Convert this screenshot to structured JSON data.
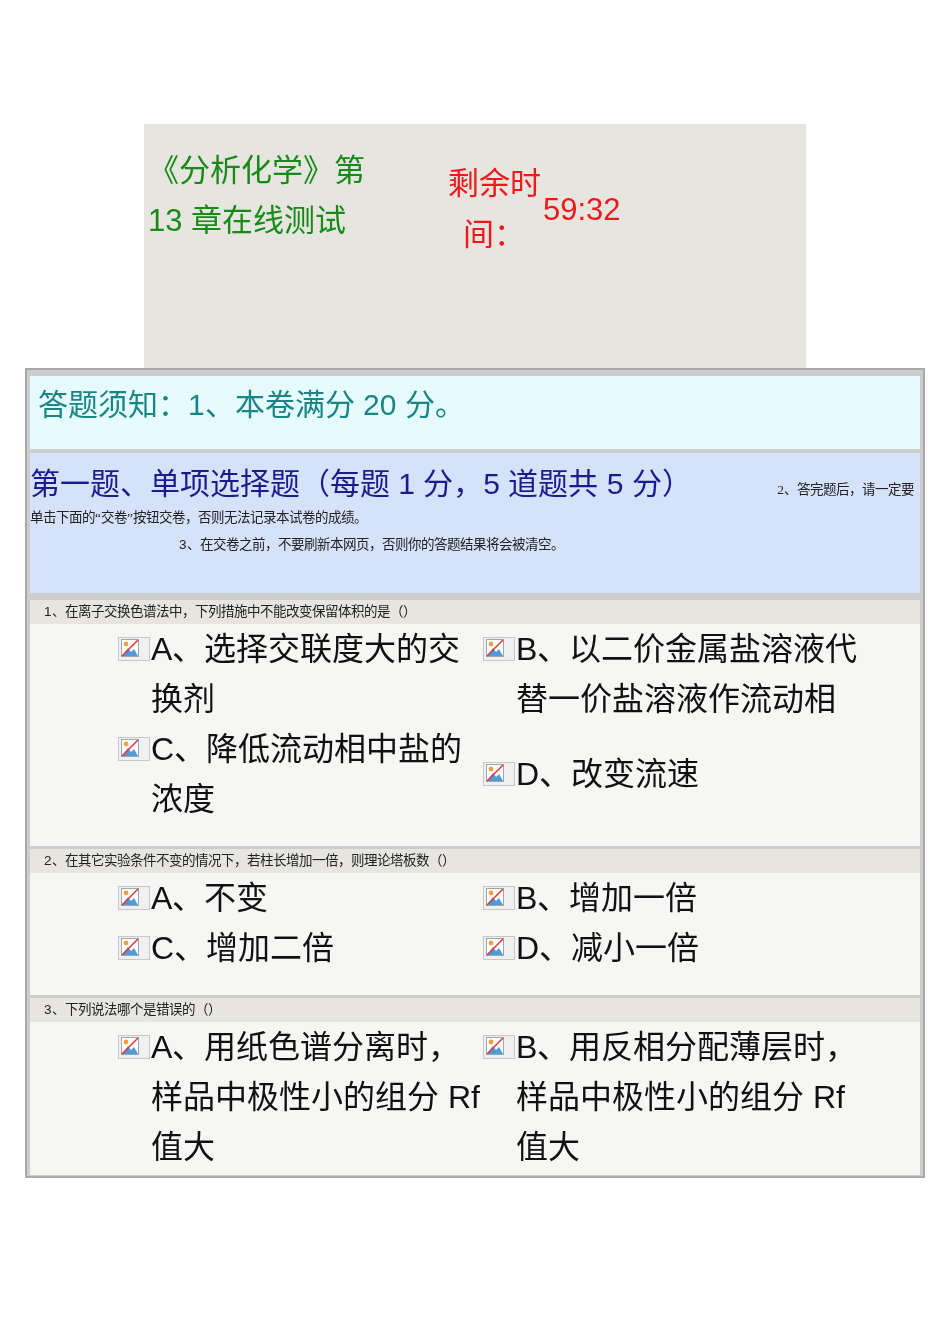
{
  "header": {
    "title": "《分析化学》第 13 章在线测试",
    "timer_label": "剩余时间：",
    "timer_value": "59:32"
  },
  "notice": {
    "text": "答题须知：1、本卷满分 20 分。"
  },
  "section": {
    "heading": "第一题、单项选择题（每题 1 分，5 道题共 5 分）",
    "notes": [
      "2、答完题后，请一定要",
      "单击下面的“交卷”按钮交卷，否则无法记录本试卷的成绩。",
      "3、在交卷之前，不要刷新本网页，否则你的答题结果将会被清空。"
    ]
  },
  "questions": [
    {
      "prompt": "1、在离子交换色谱法中，下列措施中不能改变保留体积的是（）",
      "options": [
        "A、选择交联度大的交换剂",
        "B、以二价金属盐溶液代替一价盐溶液作流动相",
        "C、降低流动相中盐的浓度",
        "D、改变流速"
      ]
    },
    {
      "prompt": "2、在其它实验条件不变的情况下，若柱长增加一倍，则理论塔板数（）",
      "options": [
        "A、不变",
        "B、增加一倍",
        "C、增加二倍",
        "D、减小一倍"
      ]
    },
    {
      "prompt": "3、下列说法哪个是错误的（）",
      "options": [
        "A、用纸色谱分离时，样品中极性小的组分 Rf 值大",
        "B、用反相分配薄层时，样品中极性小的组分 Rf 值大"
      ]
    }
  ]
}
